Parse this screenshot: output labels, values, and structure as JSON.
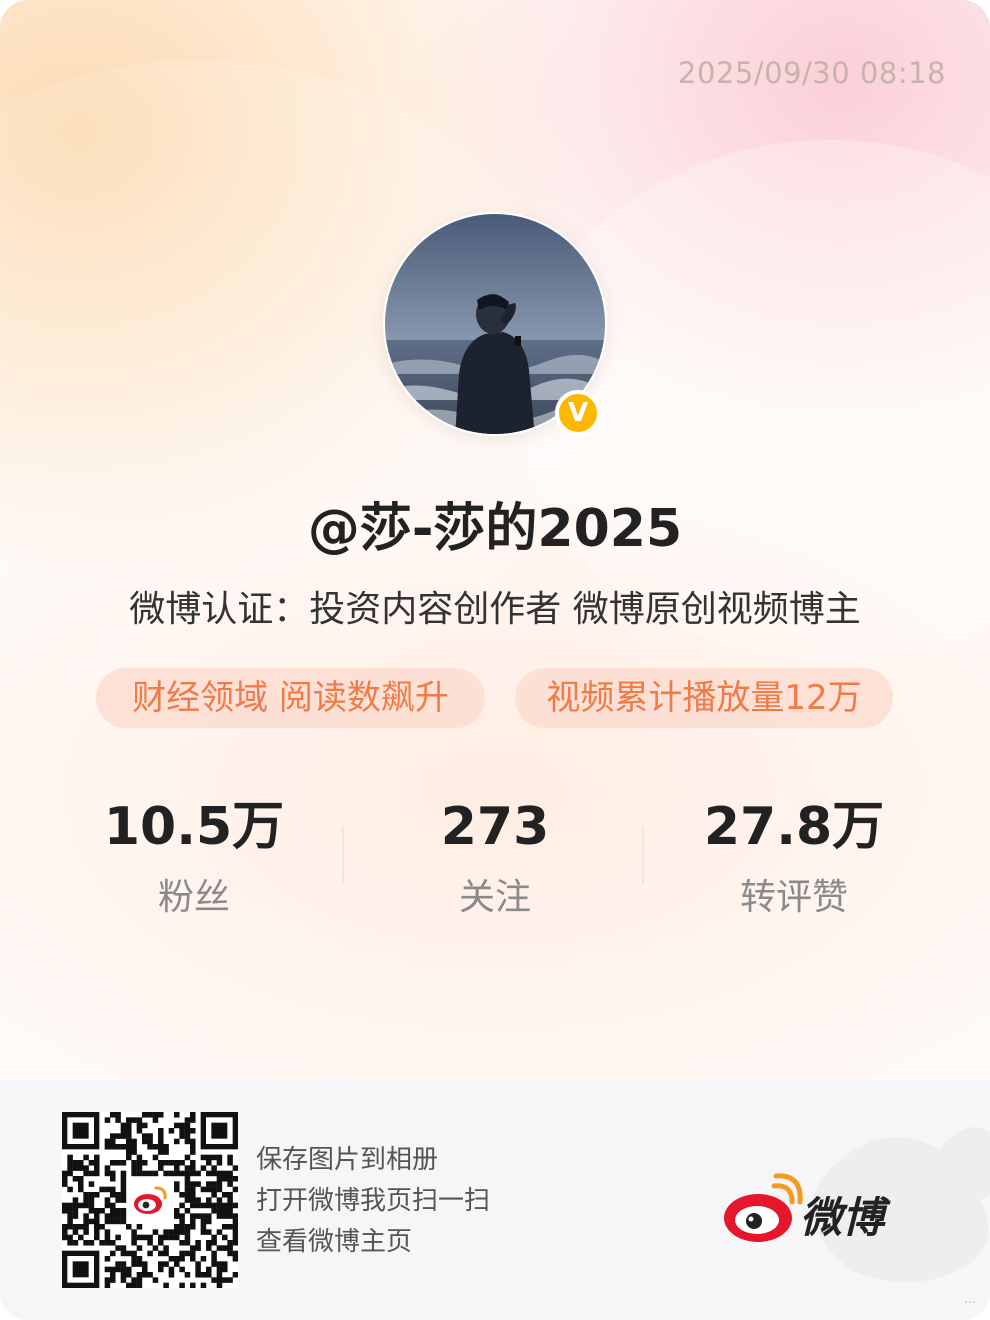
{
  "timestamp": "2025/09/30 08:18",
  "profile": {
    "username": "@莎-莎的2025",
    "verified_badge": "V",
    "certification": "微博认证：投资内容创作者 微博原创视频博主",
    "tags": [
      "财经领域 阅读数飙升",
      "视频累计播放量12万"
    ]
  },
  "stats": [
    {
      "value": "10.5万",
      "label": "粉丝"
    },
    {
      "value": "273",
      "label": "关注"
    },
    {
      "value": "27.8万",
      "label": "转评赞"
    }
  ],
  "footer": {
    "instructions": [
      "保存图片到相册",
      "打开微博我页扫一扫",
      "查看微博主页"
    ],
    "brand_name": "微博",
    "watermark": "…"
  },
  "colors": {
    "accent_orange": "#ef7c48",
    "badge_gold": "#ffb800",
    "weibo_red": "#e6162d"
  },
  "icons": [
    "verified-v-icon",
    "weibo-logo-icon",
    "qr-code"
  ]
}
